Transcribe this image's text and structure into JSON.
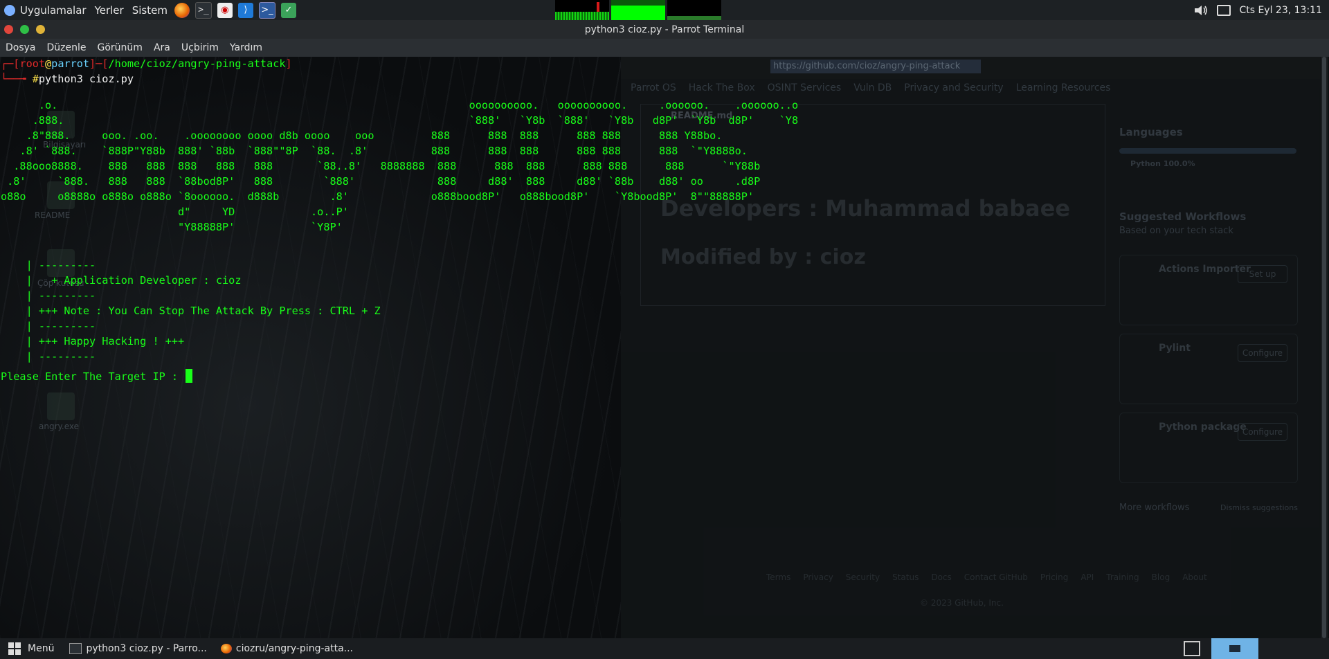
{
  "top_panel": {
    "applications": "Uygulamalar",
    "places": "Yerler",
    "system": "Sistem",
    "launchers": [
      "firefox-icon",
      "terminal-icon",
      "pdf-viewer-icon",
      "vscode-icon",
      "powershell-icon",
      "file-manager-icon"
    ],
    "clock": "Cts Eyl 23, 13:11"
  },
  "window": {
    "title": "python3 cioz.py - Parrot Terminal"
  },
  "menubar": [
    "Dosya",
    "Düzenle",
    "Görünüm",
    "Ara",
    "Uçbirim",
    "Yardım"
  ],
  "terminal": {
    "prompt_user": "root",
    "prompt_at": "@",
    "prompt_host": "parrot",
    "prompt_path": "/home/cioz/angry-ping-attack",
    "command": "python3 cioz.py",
    "banner": [
      "      .o.                                                                 oooooooooo.   oooooooooo.     .oooooo.    .oooooo..o",
      "     .888.                                                                `888'   `Y8b  `888'   `Y8b   d8P'  `Y8b  d8P'    `Y8",
      "    .8\"888.     ooo. .oo.    .oooooooo oooo d8b oooo    ooo         888      888  888      888 888      888 Y88bo.",
      "   .8' `888.    `888P\"Y88b  888' `88b  `888\"\"8P  `88.  .8'          888      888  888      888 888      888  `\"Y8888o.",
      "  .88ooo8888.    888   888  888   888   888       `88..8'   8888888  888      888  888      888 888      888      `\"Y88b",
      " .8'     `888.   888   888  `88bod8P'   888        `888'             888     d88'  888     d88' `88b    d88' oo     .d8P",
      "o88o     o8888o o888o o888o `8oooooo.  d888b        .8'             o888bood8P'   o888bood8P'    `Y8bood8P'  8\"\"88888P'",
      "                            d\"     YD            .o..P'",
      "                            \"Y88888P'            `Y8P'"
    ],
    "info": [
      "    | ---------",
      "    |   + Application Developer : cioz",
      "    | ---------",
      "    | +++ Note : You Can Stop The Attack By Press : CTRL + Z",
      "    | ---------",
      "    | +++ Happy Hacking ! +++",
      "    | ---------"
    ],
    "input_prompt": "Please Enter The Target IP : "
  },
  "background_browser": {
    "url": "https://github.com/cioz/angry-ping-attack",
    "bookmarks": [
      "Parrot OS",
      "Hack The Box",
      "OSINT Services",
      "Vuln DB",
      "Privacy and Security",
      "Learning Resources"
    ],
    "readme_file": "README.md",
    "heading1": "Developers : Muhammad babaee",
    "heading2": "Modified by : cioz",
    "languages_title": "Languages",
    "language": "Python 100.0%",
    "workflows_title": "Suggested Workflows",
    "workflows_subtitle": "Based on your tech stack",
    "workflows": [
      {
        "name": "Actions Importer",
        "action": "Set up"
      },
      {
        "name": "Pylint",
        "action": "Configure"
      },
      {
        "name": "Python package",
        "action": "Configure"
      }
    ],
    "more_workflows": "More workflows",
    "dismiss": "Dismiss suggestions",
    "footer_links": [
      "Terms",
      "Privacy",
      "Security",
      "Status",
      "Docs",
      "Contact GitHub",
      "Pricing",
      "API",
      "Training",
      "Blog",
      "About"
    ],
    "copyright": "© 2023 GitHub, Inc."
  },
  "desktop_icons": [
    "Bilgisayarı",
    "README",
    "Çöp kutusu",
    "angry.exe"
  ],
  "taskbar": {
    "menu": "Menü",
    "tasks": [
      "python3 cioz.py - Parro...",
      "ciozru/angry-ping-atta..."
    ]
  }
}
